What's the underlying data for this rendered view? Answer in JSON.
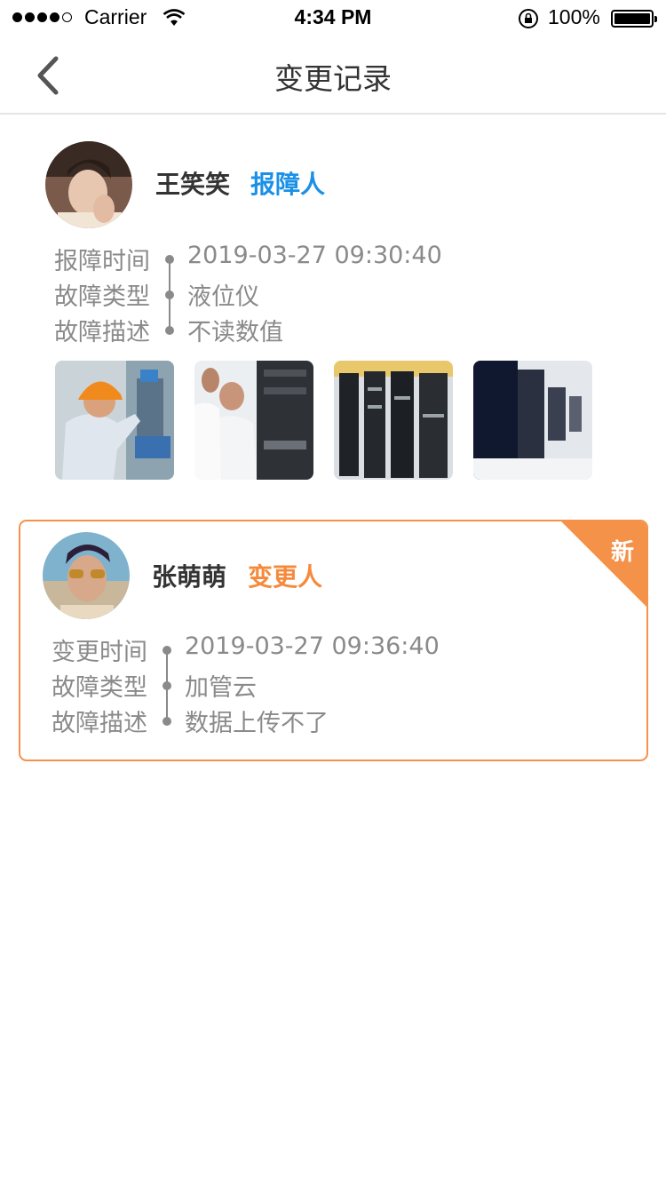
{
  "status_bar": {
    "carrier": "Carrier",
    "time": "4:34 PM",
    "battery": "100%"
  },
  "nav": {
    "title": "变更记录"
  },
  "records": [
    {
      "name": "王笑笑",
      "role": "报障人",
      "role_color": "#1a90e6",
      "fields": [
        {
          "label": "报障时间",
          "value": "2019-03-27  09:30:40"
        },
        {
          "label": "故障类型",
          "value": "液位仪"
        },
        {
          "label": "故障描述",
          "value": "不读数值"
        }
      ],
      "photos": [
        "worker-hardhat-photo",
        "server-technicians-photo",
        "server-racks-photo",
        "computer-room-photo"
      ]
    },
    {
      "name": "张萌萌",
      "role": "变更人",
      "role_color": "#f58a3c",
      "badge": "新",
      "fields": [
        {
          "label": "变更时间",
          "value": "2019-03-27  09:36:40"
        },
        {
          "label": "故障类型",
          "value": "加管云"
        },
        {
          "label": "故障描述",
          "value": "数据上传不了"
        }
      ]
    }
  ],
  "colors": {
    "accent_blue": "#1a90e6",
    "accent_orange": "#f58a3c",
    "text_gray": "#8a8a8a"
  }
}
